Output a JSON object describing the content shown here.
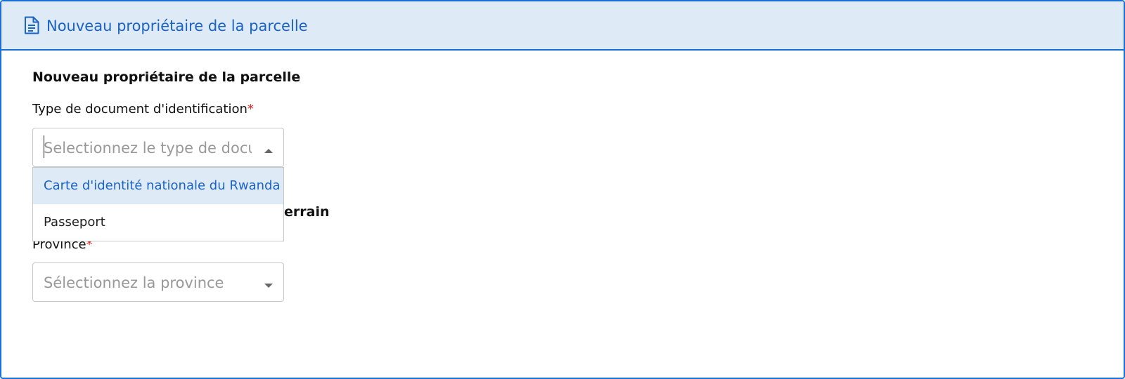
{
  "header": {
    "icon": "document-icon",
    "title": "Nouveau propriétaire de la parcelle"
  },
  "form": {
    "section_title": "Nouveau propriétaire de la parcelle",
    "document_type": {
      "label": "Type de document d'identification",
      "required_mark": "*",
      "placeholder": "Selectionnez le type de document",
      "options": [
        {
          "label": "Carte d'identité nationale du Rwanda",
          "highlighted": true
        },
        {
          "label": "Passeport",
          "highlighted": false
        }
      ]
    },
    "partially_hidden_heading": "errain",
    "province": {
      "label": "Province",
      "required_mark": "*",
      "placeholder": "Sélectionnez la province"
    }
  },
  "colors": {
    "accent": "#1a6fd6",
    "header_bg": "#dfeaf7",
    "required": "#e0221d",
    "placeholder": "#999999"
  }
}
